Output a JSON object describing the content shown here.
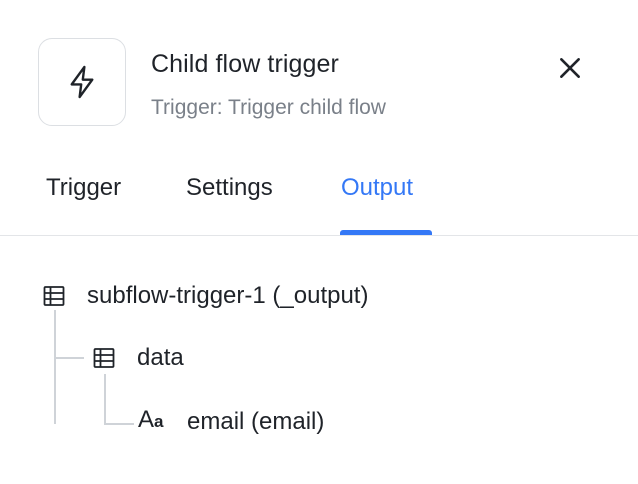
{
  "header": {
    "title": "Child flow trigger",
    "subtitle": "Trigger: Trigger child flow",
    "icon": "lightning-bolt-icon",
    "close_icon": "close-icon"
  },
  "tabs": [
    {
      "label": "Trigger",
      "active": false
    },
    {
      "label": "Settings",
      "active": false
    },
    {
      "label": "Output",
      "active": true
    }
  ],
  "accent_color": "#3478f6",
  "output_tree": {
    "root": {
      "label": "subflow-trigger-1 (_output)",
      "icon": "table-icon"
    },
    "child": {
      "label": "data",
      "icon": "table-icon"
    },
    "leaf": {
      "label": "email (email)",
      "icon": "text-type-icon",
      "icon_text": "Aa"
    }
  }
}
